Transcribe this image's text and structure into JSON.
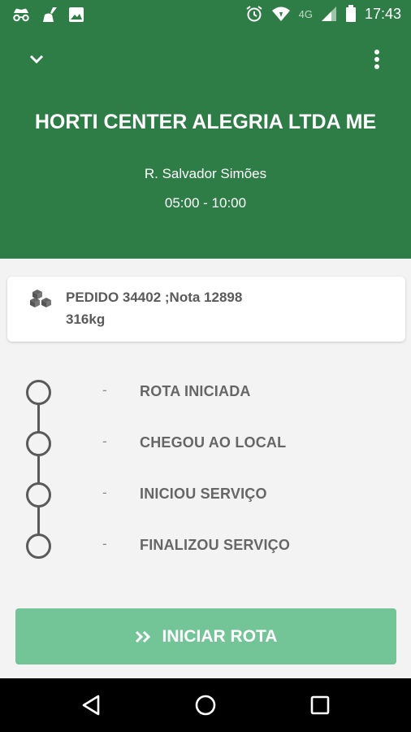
{
  "status_bar": {
    "time": "17:43",
    "network": "4G",
    "icons": [
      "incognito-icon",
      "cleaner-icon",
      "image-icon",
      "alarm-icon",
      "wifi-icon",
      "signal-icon",
      "battery-icon"
    ]
  },
  "header": {
    "title": "HORTI CENTER ALEGRIA LTDA ME",
    "address": "R. Salvador Simões",
    "time_window": "05:00 - 10:00",
    "colors": {
      "background": "#2e7d46",
      "text": "#ffffff"
    }
  },
  "order": {
    "line1": "PEDIDO 34402 ;Nota 12898",
    "line2": "316kg"
  },
  "timeline": {
    "steps": [
      {
        "time": "-",
        "label": "ROTA INICIADA"
      },
      {
        "time": "-",
        "label": "CHEGOU AO LOCAL"
      },
      {
        "time": "-",
        "label": "INICIOU SERVIÇO"
      },
      {
        "time": "-",
        "label": "FINALIZOU SERVIÇO"
      }
    ]
  },
  "action": {
    "label": "INICIAR ROTA",
    "icon": "double-chevron-right-icon",
    "color": "#73c597"
  },
  "nav": {
    "icons": [
      "back-icon",
      "home-icon",
      "recents-icon"
    ]
  }
}
